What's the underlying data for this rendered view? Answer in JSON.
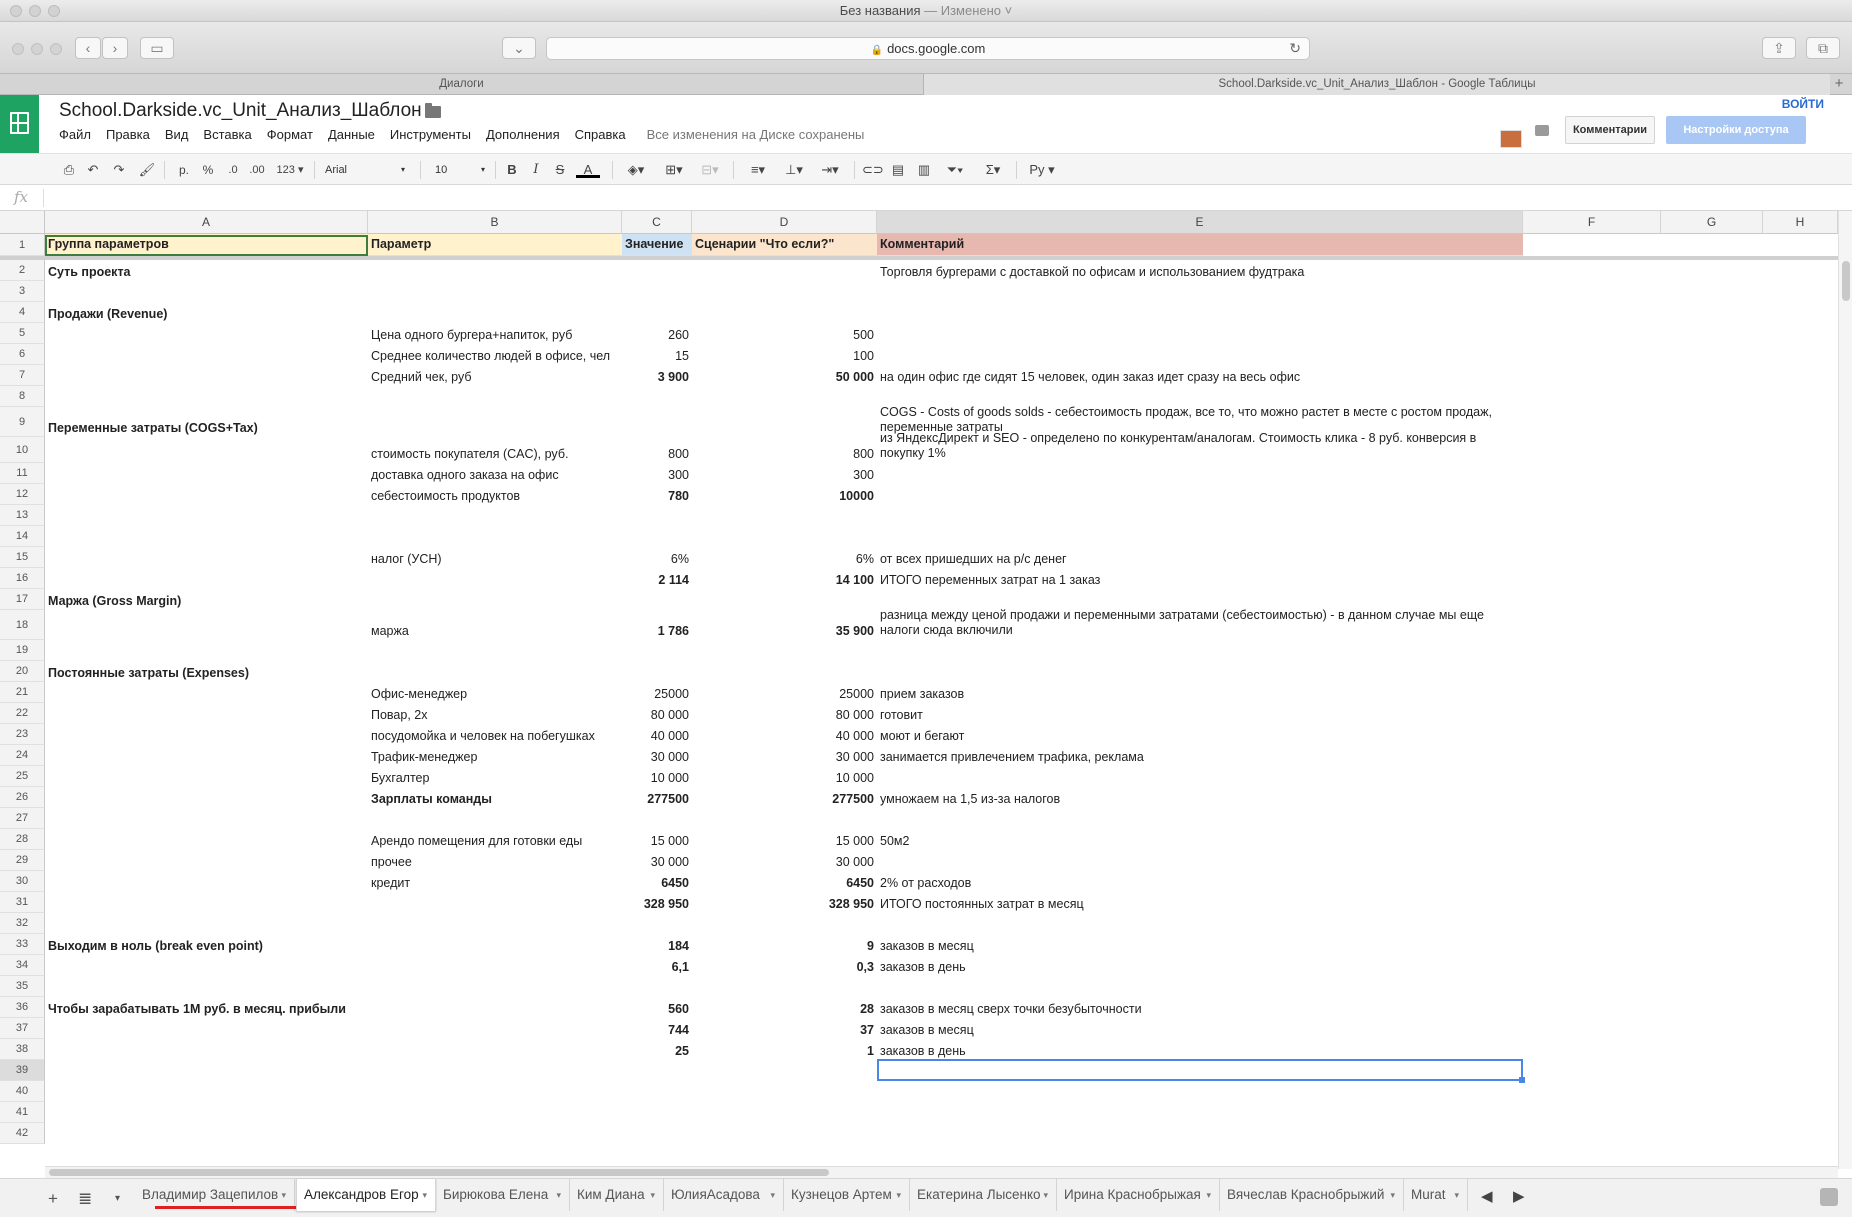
{
  "window": {
    "title": "Без названия",
    "status": "— Изменено ˅"
  },
  "browser": {
    "url": "docs.google.com",
    "tabs": [
      "Диалоги",
      "School.Darkside.vc_Unit_Анализ_Шаблон - Google Таблицы"
    ]
  },
  "doc": {
    "title": "School.Darkside.vc_Unit_Анализ_Шаблон",
    "menu": [
      "Файл",
      "Правка",
      "Вид",
      "Вставка",
      "Формат",
      "Данные",
      "Инструменты",
      "Дополнения",
      "Справка"
    ],
    "saved_status": "Все изменения на Диске сохранены",
    "signin": "ВОЙТИ",
    "comments_btn": "Комментарии",
    "share_btn": "Настройки доступа"
  },
  "toolbar": {
    "font": "Arial",
    "size": "10",
    "number_format": "123",
    "currency": "р.",
    "percent": "%",
    "decimal": ".0",
    "input_tools": "Ру"
  },
  "formula": {
    "fx": "fx",
    "value": ""
  },
  "columns": [
    "A",
    "B",
    "C",
    "D",
    "E",
    "F",
    "G",
    "H"
  ],
  "header_row": {
    "a": "Группа параметров",
    "b": "Параметр",
    "c": "Значение",
    "d": "Сценарии \"Что если?\"",
    "e": "Комментарий"
  },
  "header_colors": {
    "a": "#fff2cc",
    "b": "#fff2cc",
    "c": "#cfe2f3",
    "d": "#fce5cd",
    "e": "#e6b8af"
  },
  "rows": [
    {
      "n": "2",
      "a": "Суть проекта",
      "e": "Торговля бургерами с доставкой по офисам и использованием фудтрака"
    },
    {
      "n": "3"
    },
    {
      "n": "4",
      "a": "Продажи (Revenue)"
    },
    {
      "n": "5",
      "b": "Цена одного бургера+напиток, руб",
      "c": "260",
      "d": "500"
    },
    {
      "n": "6",
      "b": "Среднее количество людей в офисе, чел",
      "c": "15",
      "d": "100"
    },
    {
      "n": "7",
      "b": "Средний чек, руб",
      "c": "3 900",
      "d": "50 000",
      "e": "на один офис где сидят 15 человек, один заказ идет сразу на весь офис"
    },
    {
      "n": "8"
    },
    {
      "n": "9",
      "a": "Переменные затраты (COGS+Tax)",
      "e": "COGS - Costs of goods solds - себестоимость продаж, все то, что можно растет в месте с ростом продаж, переменные затраты"
    },
    {
      "n": "10",
      "b": "стоимость покупателя (CAC), руб.",
      "c": "800",
      "d": "800",
      "e": "из ЯндексДирект и SEO - определено по конкурентам/аналогам. Стоимость клика - 8 руб. конверсия в покупку 1%"
    },
    {
      "n": "11",
      "b": "доставка одного заказа на офис",
      "c": "300",
      "d": "300"
    },
    {
      "n": "12",
      "b": "себестоимость продуктов",
      "c": "780",
      "d": "10000"
    },
    {
      "n": "13"
    },
    {
      "n": "14"
    },
    {
      "n": "15",
      "b": "налог (УСН)",
      "c": "6%",
      "d": "6%",
      "e": "от всех пришедших на р/с денег"
    },
    {
      "n": "16",
      "c": "2 114",
      "d": "14 100",
      "e": "ИТОГО переменных затрат на 1 заказ"
    },
    {
      "n": "17",
      "a": "Маржа (Gross Margin)"
    },
    {
      "n": "18",
      "b": "маржа",
      "c": "1 786",
      "d": "35 900",
      "e": "разница между ценой продажи и переменными затратами (себестоимостью) - в данном случае мы еще налоги сюда включили"
    },
    {
      "n": "19"
    },
    {
      "n": "20",
      "a": "Постоянные затраты (Expenses)"
    },
    {
      "n": "21",
      "b": "Офис-менеджер",
      "c": "25000",
      "d": "25000",
      "e": "прием заказов"
    },
    {
      "n": "22",
      "b": "Повар, 2х",
      "c": "80 000",
      "d": "80 000",
      "e": "готовит"
    },
    {
      "n": "23",
      "b": "посудомойка и человек на побегушках",
      "c": "40 000",
      "d": "40 000",
      "e": "моют и бегают"
    },
    {
      "n": "24",
      "b": "Трафик-менеджер",
      "c": "30 000",
      "d": "30 000",
      "e": "занимается привлечением трафика, реклама"
    },
    {
      "n": "25",
      "b": "Бухгалтер",
      "c": "10 000",
      "d": "10 000"
    },
    {
      "n": "26",
      "b": "Зарплаты команды",
      "c": "277500",
      "d": "277500",
      "e": "умножаем на 1,5 из-за налогов"
    },
    {
      "n": "27"
    },
    {
      "n": "28",
      "b": "Арендо помещения для готовки еды",
      "c": "15 000",
      "d": "15 000",
      "e": "50м2"
    },
    {
      "n": "29",
      "b": "прочее",
      "c": "30 000",
      "d": "30 000"
    },
    {
      "n": "30",
      "b": "кредит",
      "c": "6450",
      "d": "6450",
      "e": "2% от расходов"
    },
    {
      "n": "31",
      "c": "328 950",
      "d": "328 950",
      "e": "ИТОГО постоянных затрат в месяц"
    },
    {
      "n": "32"
    },
    {
      "n": "33",
      "a": "Выходим в ноль (break even point)",
      "c": "184",
      "d": "9",
      "e": "заказов в месяц"
    },
    {
      "n": "34",
      "c": "6,1",
      "d": "0,3",
      "e": "заказов в день"
    },
    {
      "n": "35"
    },
    {
      "n": "36",
      "a": "Чтобы зарабатывать 1М руб. в месяц. прибыли",
      "c": "560",
      "d": "28",
      "e": "заказов в месяц сверх точки безубыточности"
    },
    {
      "n": "37",
      "c": "744",
      "d": "37",
      "e": " заказов в месяц"
    },
    {
      "n": "38",
      "c": "25",
      "d": "1",
      "e": "заказов в день"
    },
    {
      "n": "39"
    },
    {
      "n": "40"
    },
    {
      "n": "41"
    },
    {
      "n": "42"
    }
  ],
  "sheet_tabs": [
    "Владимир Зацепилов",
    "Александров Егор",
    "Бирюкова Елена",
    "Ким Диана",
    "ЮлияАсадова",
    "Кузнецов Артем",
    "Екатерина Лысенко",
    "Ирина Краснобрыжая",
    "Вячеслав Краснобрыжий",
    "Murat"
  ],
  "active_sheet": "Александров Егор",
  "colors": {
    "sheets_green": "#1ea362",
    "accent_blue": "#4a86e8",
    "highlight_red": "#e02020"
  }
}
